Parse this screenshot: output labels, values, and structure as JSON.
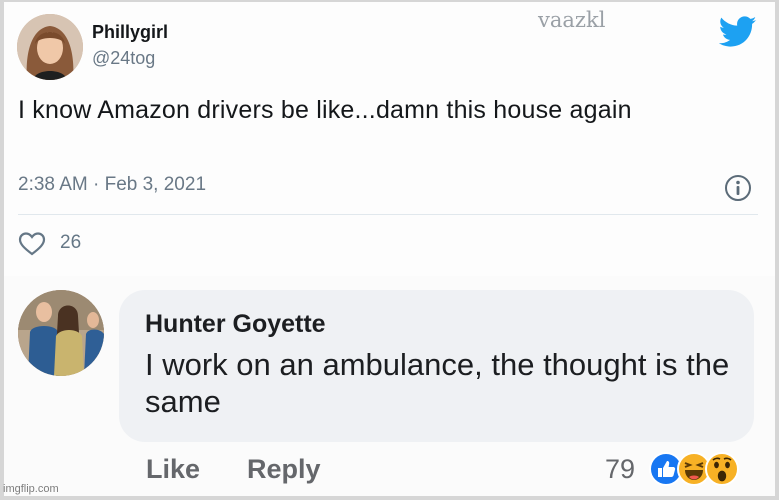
{
  "tweet": {
    "name": "Phillygirl",
    "handle": "@24tog",
    "text": "I know Amazon drivers be like...damn this house again",
    "timestamp": "2:38 AM · Feb 3, 2021",
    "like_count": "26",
    "icons": [
      "twitter-bird-icon",
      "info-icon",
      "heart-icon"
    ]
  },
  "watermark": "vaazkl",
  "comment": {
    "name": "Hunter Goyette",
    "text": "I work on an ambulance, the thought is the same",
    "like_label": "Like",
    "reply_label": "Reply",
    "reaction_count": "79",
    "reactions": [
      "like-reaction-icon",
      "haha-reaction-icon",
      "wow-reaction-icon"
    ]
  },
  "footer": "imgflip.com",
  "colors": {
    "twitter_blue": "#1da1f2",
    "facebook_blue": "#1877f2",
    "reaction_yellow": "#f7b125"
  }
}
